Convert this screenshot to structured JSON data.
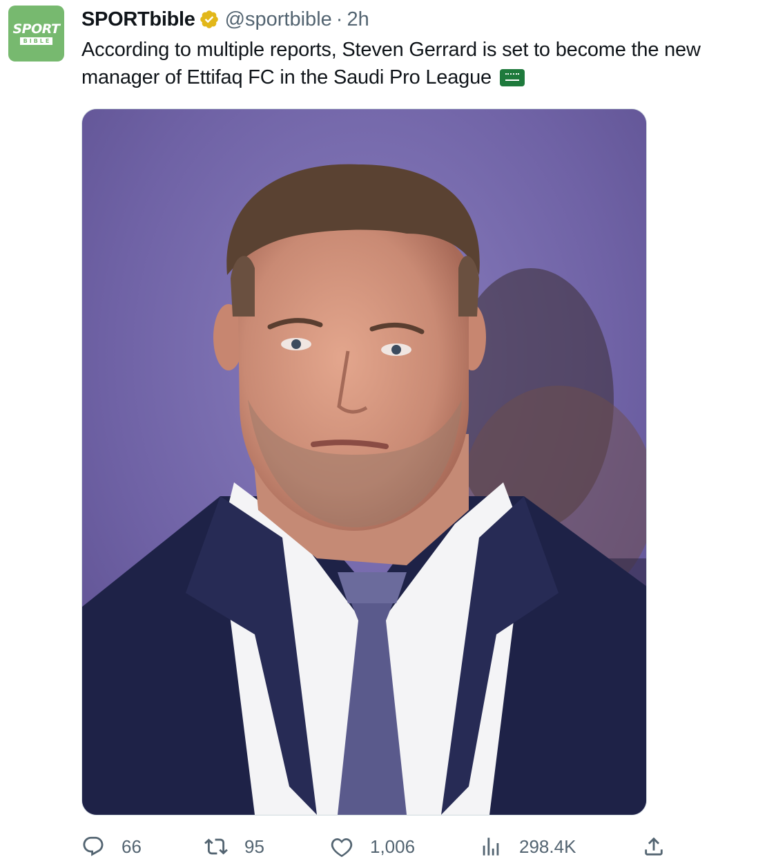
{
  "author": {
    "display_name": "SPORTbible",
    "handle": "@sportbible",
    "separator": "·",
    "time": "2h",
    "avatar_text_top": "SPORT",
    "avatar_text_bottom": "BIBLE",
    "avatar_color": "#77b96f",
    "verified_color": "#e2b719"
  },
  "tweet": {
    "text": "According to multiple reports, Steven Gerrard is set to become the new manager of Ettifaq FC in the Saudi Pro League",
    "emoji": "saudi-arabia-flag"
  },
  "metrics": {
    "replies": "66",
    "retweets": "95",
    "likes": "1,006",
    "views": "298.4K"
  },
  "icons": {
    "reply": "reply-icon",
    "retweet": "retweet-icon",
    "like": "heart-icon",
    "views": "views-icon",
    "share": "share-icon"
  },
  "colors": {
    "text": "#0f1419",
    "secondary": "#536471",
    "border": "#cfd9de"
  }
}
